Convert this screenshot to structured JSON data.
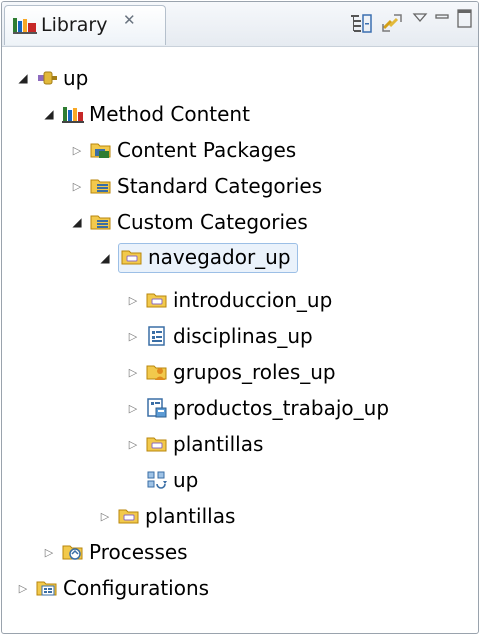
{
  "view": {
    "tab_title": "Library",
    "tab_close_glyph": "✕",
    "toolbar": {
      "icons": [
        "collapse-all-icon",
        "link-with-editor-icon",
        "view-menu-icon",
        "minimize-icon",
        "maximize-icon"
      ]
    }
  },
  "tree": {
    "items": [
      {
        "label": "up",
        "icon": "plugin-icon",
        "twisty": "open"
      },
      {
        "label": "Method Content",
        "icon": "method-content-icon",
        "twisty": "open"
      },
      {
        "label": "Content Packages",
        "icon": "content-packages-icon",
        "twisty": "closed"
      },
      {
        "label": "Standard Categories",
        "icon": "standard-categories-icon",
        "twisty": "closed"
      },
      {
        "label": "Custom Categories",
        "icon": "custom-categories-icon",
        "twisty": "open"
      },
      {
        "label": "navegador_up",
        "icon": "custom-category-icon",
        "twisty": "open",
        "selected": true
      },
      {
        "label": "introduccion_up",
        "icon": "custom-category-icon",
        "twisty": "closed"
      },
      {
        "label": "disciplinas_up",
        "icon": "discipline-grouping-icon",
        "twisty": "closed"
      },
      {
        "label": "grupos_roles_up",
        "icon": "role-set-icon",
        "twisty": "closed"
      },
      {
        "label": "productos_trabajo_up",
        "icon": "work-product-kind-icon",
        "twisty": "closed"
      },
      {
        "label": "plantillas",
        "icon": "custom-category-icon",
        "twisty": "closed"
      },
      {
        "label": "up",
        "icon": "process-reference-icon",
        "twisty": "none"
      },
      {
        "label": "plantillas",
        "icon": "custom-category-icon",
        "twisty": "closed"
      },
      {
        "label": "Processes",
        "icon": "processes-icon",
        "twisty": "closed"
      },
      {
        "label": "Configurations",
        "icon": "configurations-icon",
        "twisty": "closed"
      }
    ]
  },
  "colors": {
    "selection_bg": "#eaf2fb",
    "selection_border": "#9cbfe6",
    "frame_border": "#9aa3ad"
  }
}
